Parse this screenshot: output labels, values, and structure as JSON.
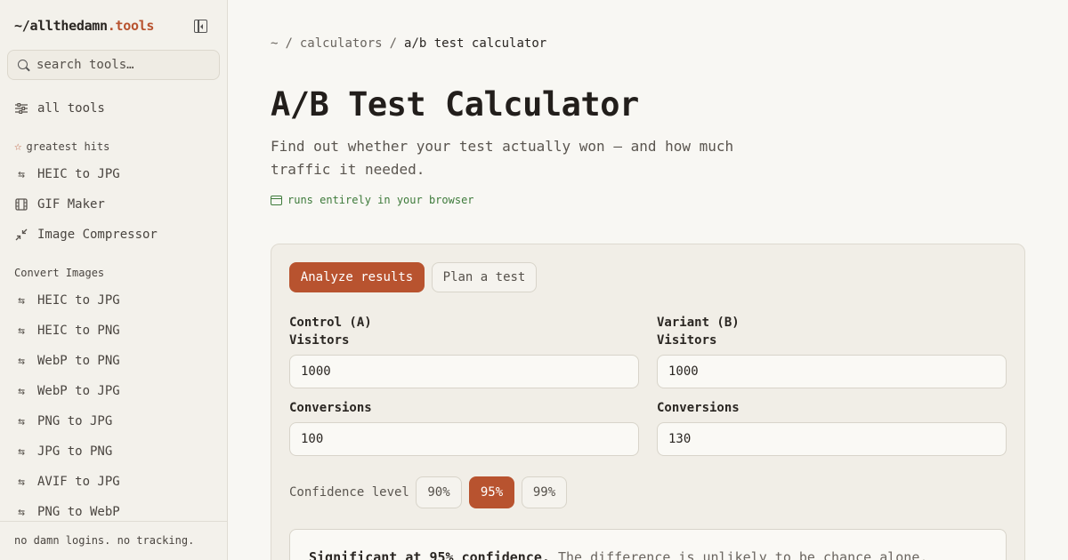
{
  "brand": {
    "prefix": "~/allthedamn",
    "suffix": ".tools"
  },
  "search": {
    "placeholder": "search tools…"
  },
  "nav": {
    "all_tools": "all tools",
    "greatest_hits_title": "greatest hits",
    "greatest_hits": [
      {
        "label": "HEIC to JPG",
        "icon": "arrows-swap-icon"
      },
      {
        "label": "GIF Maker",
        "icon": "film-icon"
      },
      {
        "label": "Image Compressor",
        "icon": "compress-icon"
      }
    ],
    "convert_title": "Convert Images",
    "convert": [
      {
        "label": "HEIC to JPG"
      },
      {
        "label": "HEIC to PNG"
      },
      {
        "label": "WebP to PNG"
      },
      {
        "label": "WebP to JPG"
      },
      {
        "label": "PNG to JPG"
      },
      {
        "label": "JPG to PNG"
      },
      {
        "label": "AVIF to JPG"
      },
      {
        "label": "PNG to WebP"
      }
    ],
    "footer": "no damn logins. no tracking."
  },
  "breadcrumb": {
    "root": "~",
    "sep": "/",
    "parent": "calculators",
    "current": "a/b test calculator"
  },
  "page": {
    "title": "A/B Test Calculator",
    "subtitle": "Find out whether your test actually won — and how much traffic it needed.",
    "badge": "runs entirely in your browser"
  },
  "tabs": {
    "analyze": "Analyze results",
    "plan": "Plan a test"
  },
  "control": {
    "title": "Control (A)",
    "visitors_label": "Visitors",
    "visitors": "1000",
    "conversions_label": "Conversions",
    "conversions": "100"
  },
  "variant": {
    "title": "Variant (B)",
    "visitors_label": "Visitors",
    "visitors": "1000",
    "conversions_label": "Conversions",
    "conversions": "130"
  },
  "confidence": {
    "label": "Confidence level",
    "options": [
      "90%",
      "95%",
      "99%"
    ],
    "selected": "95%"
  },
  "result": {
    "headline": "Significant at 95% confidence.",
    "detail": "The difference is unlikely to be chance alone."
  },
  "colors": {
    "accent": "#b8532f",
    "success": "#3d7a3a",
    "background": "#f8f7f3"
  }
}
